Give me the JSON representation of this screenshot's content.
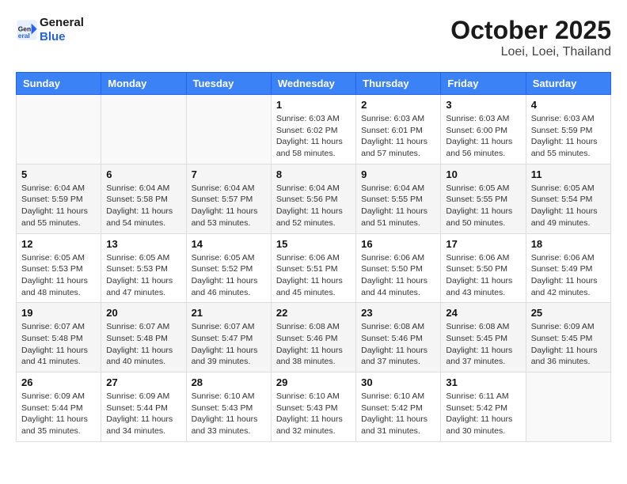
{
  "header": {
    "logo_line1": "General",
    "logo_line2": "Blue",
    "month": "October 2025",
    "location": "Loei, Loei, Thailand"
  },
  "weekdays": [
    "Sunday",
    "Monday",
    "Tuesday",
    "Wednesday",
    "Thursday",
    "Friday",
    "Saturday"
  ],
  "weeks": [
    [
      {
        "day": "",
        "sunrise": "",
        "sunset": "",
        "daylight": ""
      },
      {
        "day": "",
        "sunrise": "",
        "sunset": "",
        "daylight": ""
      },
      {
        "day": "",
        "sunrise": "",
        "sunset": "",
        "daylight": ""
      },
      {
        "day": "1",
        "sunrise": "Sunrise: 6:03 AM",
        "sunset": "Sunset: 6:02 PM",
        "daylight": "Daylight: 11 hours and 58 minutes."
      },
      {
        "day": "2",
        "sunrise": "Sunrise: 6:03 AM",
        "sunset": "Sunset: 6:01 PM",
        "daylight": "Daylight: 11 hours and 57 minutes."
      },
      {
        "day": "3",
        "sunrise": "Sunrise: 6:03 AM",
        "sunset": "Sunset: 6:00 PM",
        "daylight": "Daylight: 11 hours and 56 minutes."
      },
      {
        "day": "4",
        "sunrise": "Sunrise: 6:03 AM",
        "sunset": "Sunset: 5:59 PM",
        "daylight": "Daylight: 11 hours and 55 minutes."
      }
    ],
    [
      {
        "day": "5",
        "sunrise": "Sunrise: 6:04 AM",
        "sunset": "Sunset: 5:59 PM",
        "daylight": "Daylight: 11 hours and 55 minutes."
      },
      {
        "day": "6",
        "sunrise": "Sunrise: 6:04 AM",
        "sunset": "Sunset: 5:58 PM",
        "daylight": "Daylight: 11 hours and 54 minutes."
      },
      {
        "day": "7",
        "sunrise": "Sunrise: 6:04 AM",
        "sunset": "Sunset: 5:57 PM",
        "daylight": "Daylight: 11 hours and 53 minutes."
      },
      {
        "day": "8",
        "sunrise": "Sunrise: 6:04 AM",
        "sunset": "Sunset: 5:56 PM",
        "daylight": "Daylight: 11 hours and 52 minutes."
      },
      {
        "day": "9",
        "sunrise": "Sunrise: 6:04 AM",
        "sunset": "Sunset: 5:55 PM",
        "daylight": "Daylight: 11 hours and 51 minutes."
      },
      {
        "day": "10",
        "sunrise": "Sunrise: 6:05 AM",
        "sunset": "Sunset: 5:55 PM",
        "daylight": "Daylight: 11 hours and 50 minutes."
      },
      {
        "day": "11",
        "sunrise": "Sunrise: 6:05 AM",
        "sunset": "Sunset: 5:54 PM",
        "daylight": "Daylight: 11 hours and 49 minutes."
      }
    ],
    [
      {
        "day": "12",
        "sunrise": "Sunrise: 6:05 AM",
        "sunset": "Sunset: 5:53 PM",
        "daylight": "Daylight: 11 hours and 48 minutes."
      },
      {
        "day": "13",
        "sunrise": "Sunrise: 6:05 AM",
        "sunset": "Sunset: 5:53 PM",
        "daylight": "Daylight: 11 hours and 47 minutes."
      },
      {
        "day": "14",
        "sunrise": "Sunrise: 6:05 AM",
        "sunset": "Sunset: 5:52 PM",
        "daylight": "Daylight: 11 hours and 46 minutes."
      },
      {
        "day": "15",
        "sunrise": "Sunrise: 6:06 AM",
        "sunset": "Sunset: 5:51 PM",
        "daylight": "Daylight: 11 hours and 45 minutes."
      },
      {
        "day": "16",
        "sunrise": "Sunrise: 6:06 AM",
        "sunset": "Sunset: 5:50 PM",
        "daylight": "Daylight: 11 hours and 44 minutes."
      },
      {
        "day": "17",
        "sunrise": "Sunrise: 6:06 AM",
        "sunset": "Sunset: 5:50 PM",
        "daylight": "Daylight: 11 hours and 43 minutes."
      },
      {
        "day": "18",
        "sunrise": "Sunrise: 6:06 AM",
        "sunset": "Sunset: 5:49 PM",
        "daylight": "Daylight: 11 hours and 42 minutes."
      }
    ],
    [
      {
        "day": "19",
        "sunrise": "Sunrise: 6:07 AM",
        "sunset": "Sunset: 5:48 PM",
        "daylight": "Daylight: 11 hours and 41 minutes."
      },
      {
        "day": "20",
        "sunrise": "Sunrise: 6:07 AM",
        "sunset": "Sunset: 5:48 PM",
        "daylight": "Daylight: 11 hours and 40 minutes."
      },
      {
        "day": "21",
        "sunrise": "Sunrise: 6:07 AM",
        "sunset": "Sunset: 5:47 PM",
        "daylight": "Daylight: 11 hours and 39 minutes."
      },
      {
        "day": "22",
        "sunrise": "Sunrise: 6:08 AM",
        "sunset": "Sunset: 5:46 PM",
        "daylight": "Daylight: 11 hours and 38 minutes."
      },
      {
        "day": "23",
        "sunrise": "Sunrise: 6:08 AM",
        "sunset": "Sunset: 5:46 PM",
        "daylight": "Daylight: 11 hours and 37 minutes."
      },
      {
        "day": "24",
        "sunrise": "Sunrise: 6:08 AM",
        "sunset": "Sunset: 5:45 PM",
        "daylight": "Daylight: 11 hours and 37 minutes."
      },
      {
        "day": "25",
        "sunrise": "Sunrise: 6:09 AM",
        "sunset": "Sunset: 5:45 PM",
        "daylight": "Daylight: 11 hours and 36 minutes."
      }
    ],
    [
      {
        "day": "26",
        "sunrise": "Sunrise: 6:09 AM",
        "sunset": "Sunset: 5:44 PM",
        "daylight": "Daylight: 11 hours and 35 minutes."
      },
      {
        "day": "27",
        "sunrise": "Sunrise: 6:09 AM",
        "sunset": "Sunset: 5:44 PM",
        "daylight": "Daylight: 11 hours and 34 minutes."
      },
      {
        "day": "28",
        "sunrise": "Sunrise: 6:10 AM",
        "sunset": "Sunset: 5:43 PM",
        "daylight": "Daylight: 11 hours and 33 minutes."
      },
      {
        "day": "29",
        "sunrise": "Sunrise: 6:10 AM",
        "sunset": "Sunset: 5:43 PM",
        "daylight": "Daylight: 11 hours and 32 minutes."
      },
      {
        "day": "30",
        "sunrise": "Sunrise: 6:10 AM",
        "sunset": "Sunset: 5:42 PM",
        "daylight": "Daylight: 11 hours and 31 minutes."
      },
      {
        "day": "31",
        "sunrise": "Sunrise: 6:11 AM",
        "sunset": "Sunset: 5:42 PM",
        "daylight": "Daylight: 11 hours and 30 minutes."
      },
      {
        "day": "",
        "sunrise": "",
        "sunset": "",
        "daylight": ""
      }
    ]
  ]
}
